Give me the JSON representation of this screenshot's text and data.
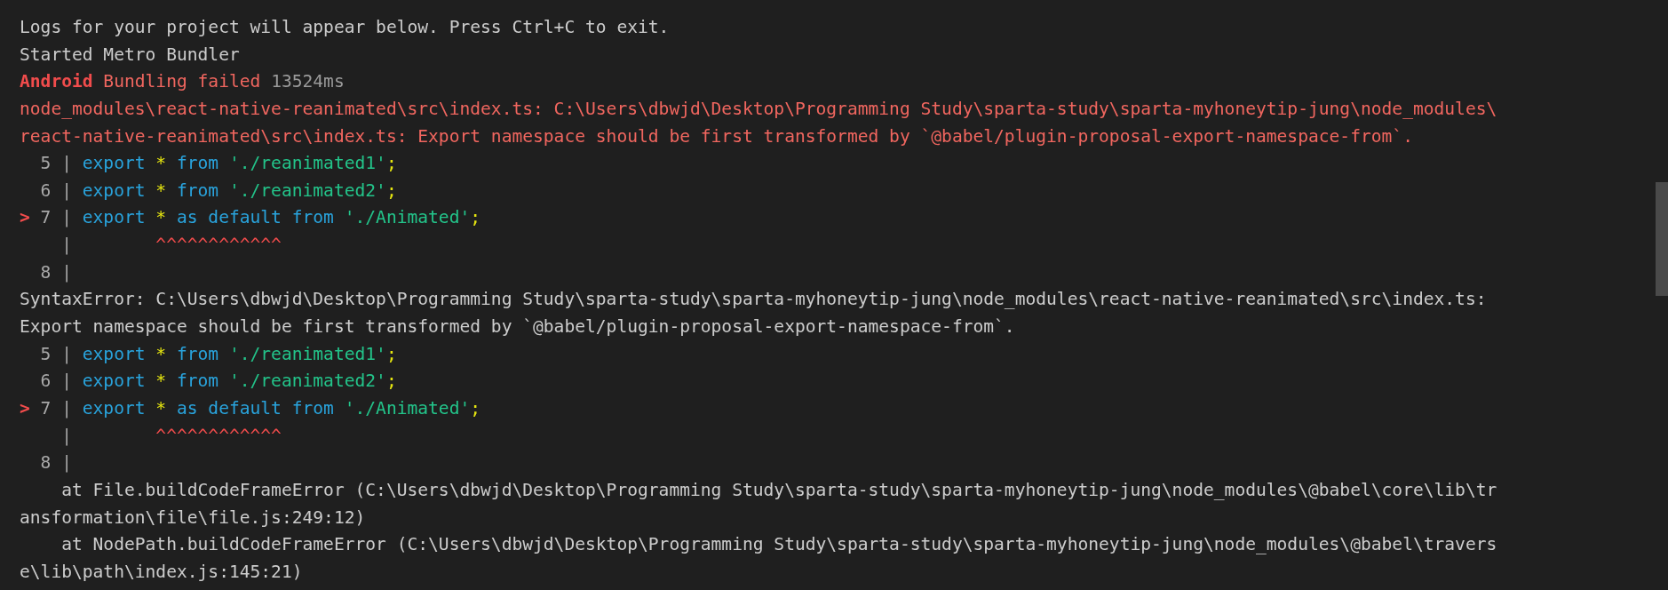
{
  "terminal": {
    "lines": [
      [
        {
          "text": "Logs for your project will appear below. Press Ctrl+C to exit.",
          "kind": "plain"
        }
      ],
      [
        {
          "text": "Started Metro Bundler",
          "kind": "plain"
        }
      ],
      [
        {
          "text": "Android",
          "kind": "error_bold"
        },
        {
          "text": " Bundling failed ",
          "kind": "error"
        },
        {
          "text": "13524ms",
          "kind": "dim"
        }
      ],
      [
        {
          "text": "node_modules\\react-native-reanimated\\src\\index.ts: C:\\Users\\dbwjd\\Desktop\\Programming Study\\sparta-study\\sparta-myhoneytip-jung\\node_modules\\",
          "kind": "error"
        }
      ],
      [
        {
          "text": "react-native-reanimated\\src\\index.ts: Export namespace should be first transformed by `@babel/plugin-proposal-export-namespace-from`.",
          "kind": "error"
        }
      ],
      [
        {
          "text": "  5 | ",
          "kind": "gutter"
        },
        {
          "text": "export",
          "kind": "keyword"
        },
        {
          "text": " * ",
          "kind": "operator"
        },
        {
          "text": "from",
          "kind": "keyword"
        },
        {
          "text": " './reanimated1'",
          "kind": "string"
        },
        {
          "text": ";",
          "kind": "operator"
        }
      ],
      [
        {
          "text": "  6 | ",
          "kind": "gutter"
        },
        {
          "text": "export",
          "kind": "keyword"
        },
        {
          "text": " * ",
          "kind": "operator"
        },
        {
          "text": "from",
          "kind": "keyword"
        },
        {
          "text": " './reanimated2'",
          "kind": "string"
        },
        {
          "text": ";",
          "kind": "operator"
        }
      ],
      [
        {
          "text": ">",
          "kind": "marker"
        },
        {
          "text": " 7 | ",
          "kind": "gutter"
        },
        {
          "text": "export",
          "kind": "keyword"
        },
        {
          "text": " * ",
          "kind": "operator"
        },
        {
          "text": "as default from",
          "kind": "keyword"
        },
        {
          "text": " './Animated'",
          "kind": "string"
        },
        {
          "text": ";",
          "kind": "operator"
        }
      ],
      [
        {
          "text": "    | ",
          "kind": "gutter"
        },
        {
          "text": "       ^^^^^^^^^^^^",
          "kind": "caret"
        }
      ],
      [
        {
          "text": "  8 |",
          "kind": "gutter"
        }
      ],
      [
        {
          "text": "SyntaxError: C:\\Users\\dbwjd\\Desktop\\Programming Study\\sparta-study\\sparta-myhoneytip-jung\\node_modules\\react-native-reanimated\\src\\index.ts:",
          "kind": "plain"
        }
      ],
      [
        {
          "text": "Export namespace should be first transformed by `@babel/plugin-proposal-export-namespace-from`.",
          "kind": "plain"
        }
      ],
      [
        {
          "text": "  5 | ",
          "kind": "gutter"
        },
        {
          "text": "export",
          "kind": "keyword"
        },
        {
          "text": " * ",
          "kind": "operator"
        },
        {
          "text": "from",
          "kind": "keyword"
        },
        {
          "text": " './reanimated1'",
          "kind": "string"
        },
        {
          "text": ";",
          "kind": "operator"
        }
      ],
      [
        {
          "text": "  6 | ",
          "kind": "gutter"
        },
        {
          "text": "export",
          "kind": "keyword"
        },
        {
          "text": " * ",
          "kind": "operator"
        },
        {
          "text": "from",
          "kind": "keyword"
        },
        {
          "text": " './reanimated2'",
          "kind": "string"
        },
        {
          "text": ";",
          "kind": "operator"
        }
      ],
      [
        {
          "text": ">",
          "kind": "marker"
        },
        {
          "text": " 7 | ",
          "kind": "gutter"
        },
        {
          "text": "export",
          "kind": "keyword"
        },
        {
          "text": " * ",
          "kind": "operator"
        },
        {
          "text": "as default from",
          "kind": "keyword"
        },
        {
          "text": " './Animated'",
          "kind": "string"
        },
        {
          "text": ";",
          "kind": "operator"
        }
      ],
      [
        {
          "text": "    | ",
          "kind": "gutter"
        },
        {
          "text": "       ^^^^^^^^^^^^",
          "kind": "caret"
        }
      ],
      [
        {
          "text": "  8 |",
          "kind": "gutter"
        }
      ],
      [
        {
          "text": "    at File.buildCodeFrameError (C:\\Users\\dbwjd\\Desktop\\Programming Study\\sparta-study\\sparta-myhoneytip-jung\\node_modules\\@babel\\core\\lib\\tr",
          "kind": "plain"
        }
      ],
      [
        {
          "text": "ansformation\\file\\file.js:249:12)",
          "kind": "plain"
        }
      ],
      [
        {
          "text": "    at NodePath.buildCodeFrameError (C:\\Users\\dbwjd\\Desktop\\Programming Study\\sparta-study\\sparta-myhoneytip-jung\\node_modules\\@babel\\travers",
          "kind": "plain"
        }
      ],
      [
        {
          "text": "e\\lib\\path\\index.js:145:21)",
          "kind": "plain"
        }
      ]
    ]
  }
}
